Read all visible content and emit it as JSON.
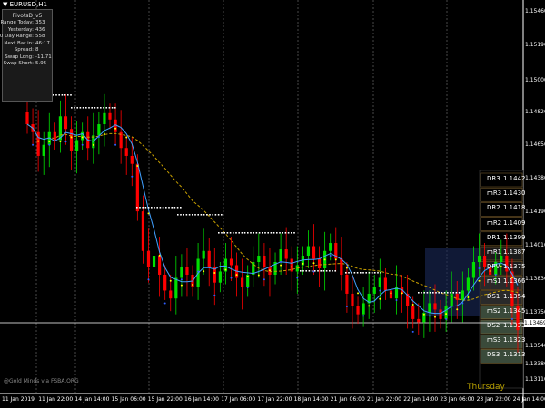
{
  "title": "▼ EURUSD,H1",
  "pivot_info": {
    "header": "PivotsD_v5",
    "rows": [
      {
        "label": "Range Today:",
        "value": "353"
      },
      {
        "label": "Yesterday:",
        "value": "436"
      },
      {
        "label": "30 Day Range:",
        "value": "558"
      },
      {
        "label": "Next Bar in:",
        "value": "46:17"
      },
      {
        "label": "Spread:",
        "value": "8"
      },
      {
        "label": "Swap Long:",
        "value": "-11.71"
      },
      {
        "label": "Swap Short:",
        "value": "5.95"
      }
    ]
  },
  "pivots": [
    {
      "label": "DR3",
      "value": "1.1442"
    },
    {
      "label": "mR3",
      "value": "1.1430"
    },
    {
      "label": "DR2",
      "value": "1.1418"
    },
    {
      "label": "mR2",
      "value": "1.1409"
    },
    {
      "label": "DR1",
      "value": "1.1399"
    },
    {
      "label": "mR1",
      "value": "1.1387"
    },
    {
      "label": "DPV",
      "value": "1.1375"
    },
    {
      "label": "mS1",
      "value": "1.1366"
    },
    {
      "label": "DS1",
      "value": "1.1354"
    },
    {
      "label": "mS2",
      "value": "1.1345"
    },
    {
      "label": "DS2",
      "value": "1.1333"
    },
    {
      "label": "mS3",
      "value": "1.1323"
    },
    {
      "label": "DS3",
      "value": "1.1313"
    }
  ],
  "price_axis": [
    "1.15460",
    "1.15190",
    "1.15000",
    "1.14820",
    "1.14650",
    "1.14380",
    "1.14190",
    "1.14010",
    "1.13830",
    "1.13750",
    "1.13540",
    "1.13380",
    "1.13110"
  ],
  "current_price": "1.13469",
  "time_axis": [
    "11 Jan 2019",
    "11 Jan 22:00",
    "14 Jan 14:00",
    "15 Jan 06:00",
    "15 Jan 22:00",
    "16 Jan 14:00",
    "17 Jan 06:00",
    "17 Jan 22:00",
    "18 Jan 14:00",
    "21 Jan 06:00",
    "21 Jan 22:00",
    "22 Jan 14:00",
    "23 Jan 06:00",
    "23 Jan 22:00",
    "24 Jan 14:00"
  ],
  "footer": "@Gold Minds via FSBA.ORG",
  "day_name": "Thursday",
  "colors": {
    "bear_candle": "#ff0000",
    "bull_candle": "#00e000",
    "ma_line": "#c8a000",
    "fast_line": "#40a0ff",
    "signal_dots": "#ffff00",
    "support_dots": "#3060ff",
    "level_dots": "#ffffff",
    "box": "#1a2a5a"
  },
  "chart_data": {
    "type": "candlestick",
    "price_range": [
      1.1305,
      1.155
    ],
    "current_price": 1.13469,
    "close": [
      1.1475,
      1.147,
      1.1455,
      1.1462,
      1.147,
      1.1465,
      1.148,
      1.1472,
      1.1458,
      1.1465,
      1.147,
      1.146,
      1.1468,
      1.1475,
      1.1482,
      1.1478,
      1.147,
      1.146,
      1.1455,
      1.145,
      1.142,
      1.1395,
      1.1385,
      1.1392,
      1.138,
      1.137,
      1.1365,
      1.1378,
      1.1385,
      1.138,
      1.1372,
      1.139,
      1.1395,
      1.1385,
      1.1375,
      1.1382,
      1.139,
      1.1386,
      1.1378,
      1.1372,
      1.138,
      1.1388,
      1.1392,
      1.1385,
      1.138,
      1.1388,
      1.1396,
      1.139,
      1.1382,
      1.1386,
      1.1392,
      1.1398,
      1.139,
      1.1384,
      1.1395,
      1.14,
      1.139,
      1.138,
      1.1368,
      1.136,
      1.1355,
      1.1362,
      1.1368,
      1.1372,
      1.1378,
      1.137,
      1.1365,
      1.1372,
      1.1368,
      1.136,
      1.1352,
      1.135,
      1.1356,
      1.1362,
      1.1358,
      1.1352,
      1.136,
      1.1368,
      1.1364,
      1.137,
      1.1378,
      1.1388,
      1.1392,
      1.1385,
      1.138,
      1.1388,
      1.1392,
      1.1382,
      1.136,
      1.1345
    ]
  }
}
